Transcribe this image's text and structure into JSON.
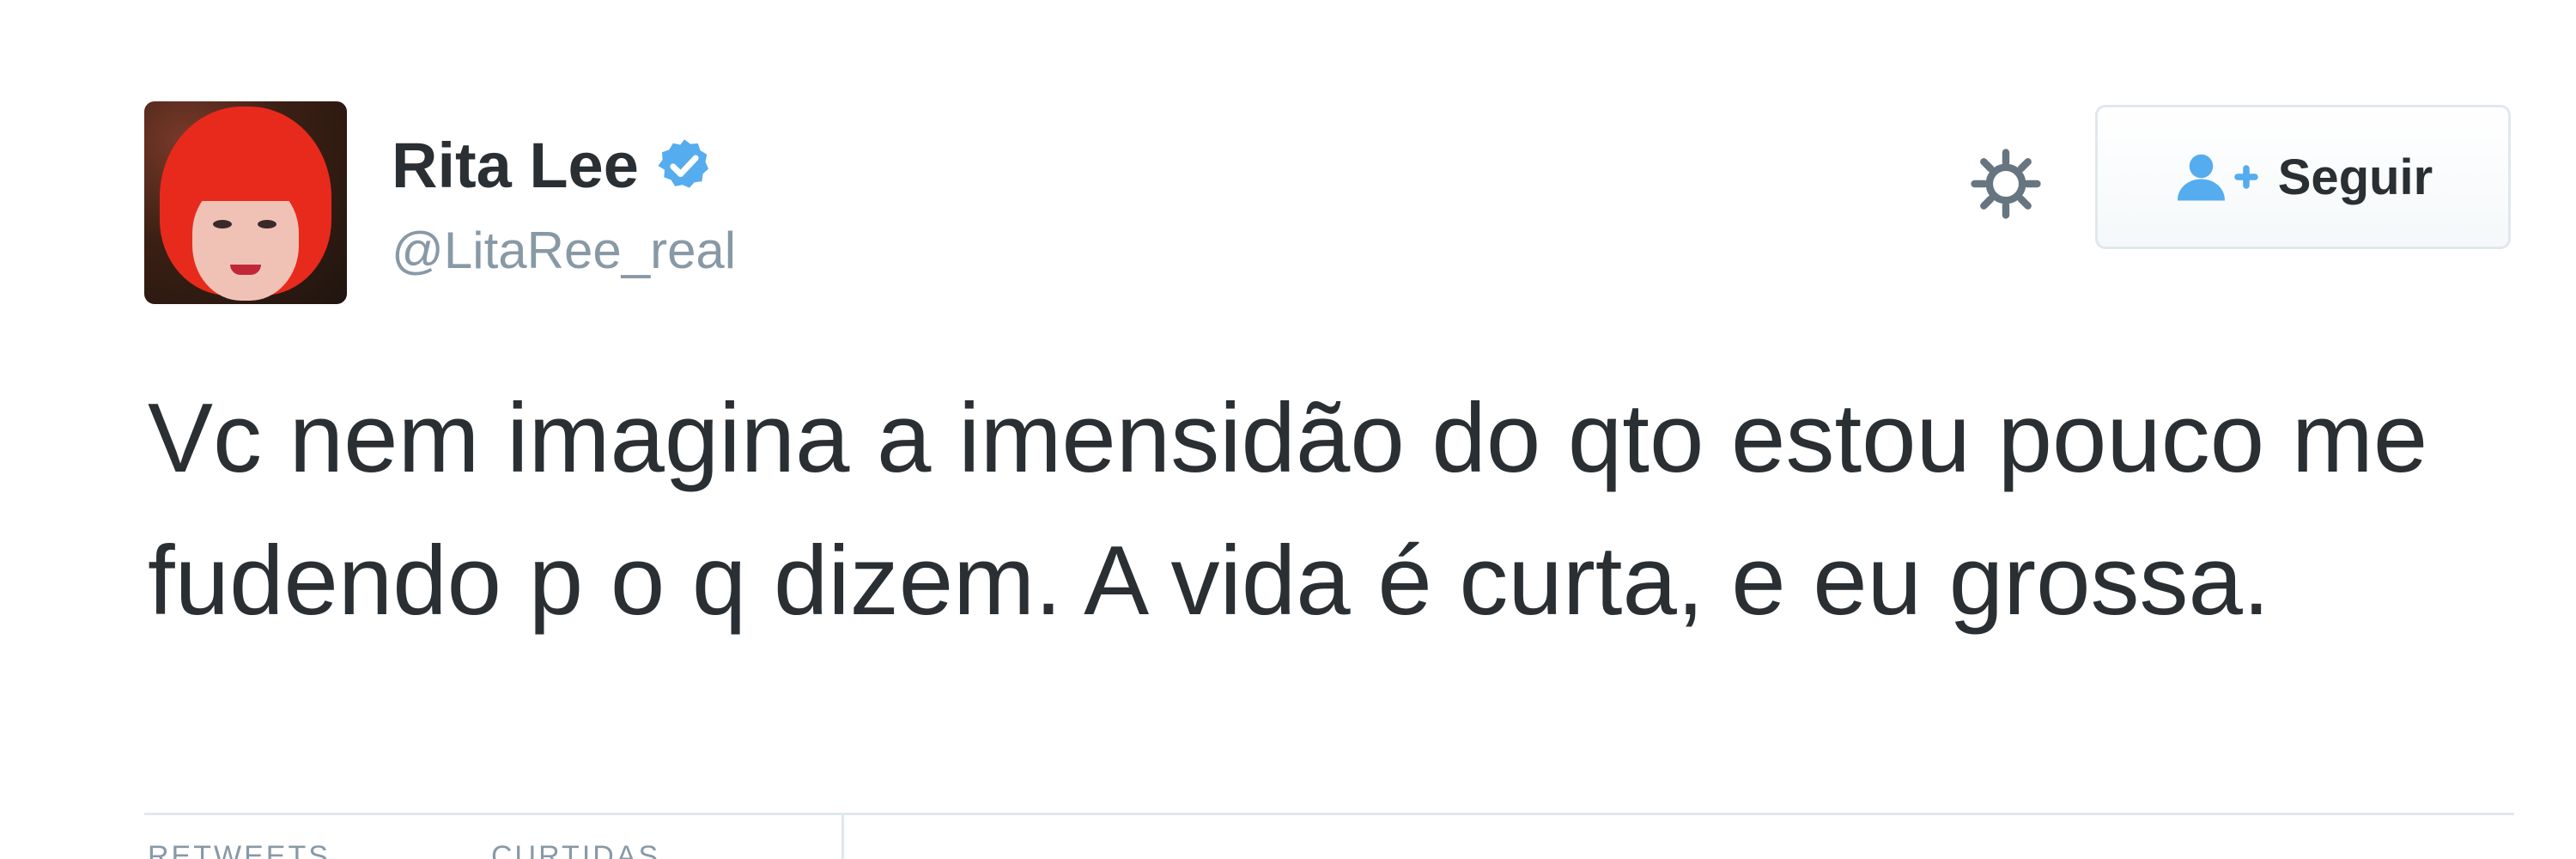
{
  "tweet": {
    "author": {
      "display_name": "Rita Lee",
      "handle": "@LitaRee_real",
      "verified": true
    },
    "follow_button": {
      "label": "Seguir",
      "icon": "follow-user-icon"
    },
    "settings_icon": "gear-icon",
    "text": "Vc nem imagina a imensidão do qto estou pouco me fudendo p o q dizem. A vida é curta, e eu grossa.",
    "stats": {
      "retweets_label": "RETWEETS",
      "likes_label": "CURTIDAS"
    }
  },
  "colors": {
    "text": "#292f33",
    "muted": "#8899a6",
    "verified": "#55acee",
    "follow_icon": "#55acee",
    "border": "#e1e8ed"
  }
}
